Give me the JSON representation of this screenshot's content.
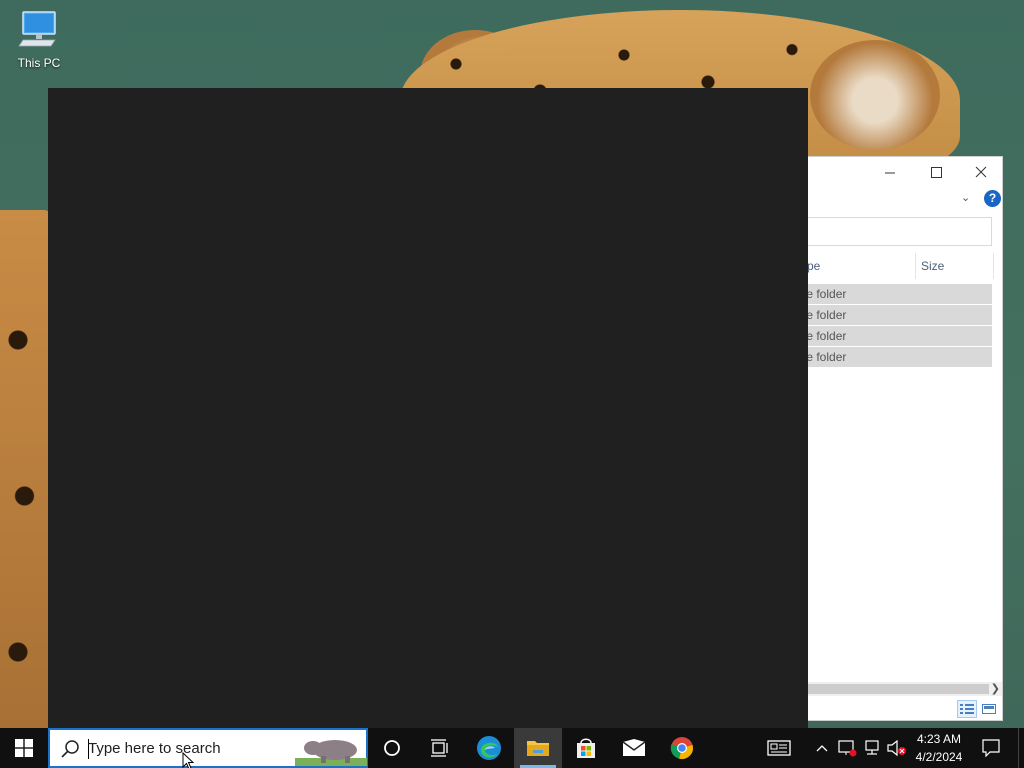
{
  "desktop": {
    "icons": [
      {
        "label": "This PC",
        "icon": "this-pc-icon"
      }
    ]
  },
  "explorer": {
    "columns": {
      "type": "ype",
      "size": "Size"
    },
    "rows": [
      {
        "type": "ile folder"
      },
      {
        "type": "ile folder"
      },
      {
        "type": "ile folder"
      },
      {
        "type": "ile folder"
      }
    ],
    "help_label": "?"
  },
  "taskbar": {
    "search_placeholder": "Type here to search",
    "pinned": [
      {
        "name": "Cortana",
        "icon": "cortana-icon"
      },
      {
        "name": "Task View",
        "icon": "task-view-icon"
      },
      {
        "name": "Microsoft Edge",
        "icon": "edge-icon"
      },
      {
        "name": "File Explorer",
        "icon": "file-explorer-icon",
        "active": true
      },
      {
        "name": "Microsoft Store",
        "icon": "store-icon"
      },
      {
        "name": "Mail",
        "icon": "mail-icon"
      },
      {
        "name": "Google Chrome",
        "icon": "chrome-icon"
      }
    ],
    "clock": {
      "time": "4:23 AM",
      "date": "4/2/2024"
    }
  },
  "colors": {
    "accent": "#1a73c8",
    "taskbar": "#101010",
    "dark_window": "#202020",
    "help_blue": "#1a66c4"
  }
}
